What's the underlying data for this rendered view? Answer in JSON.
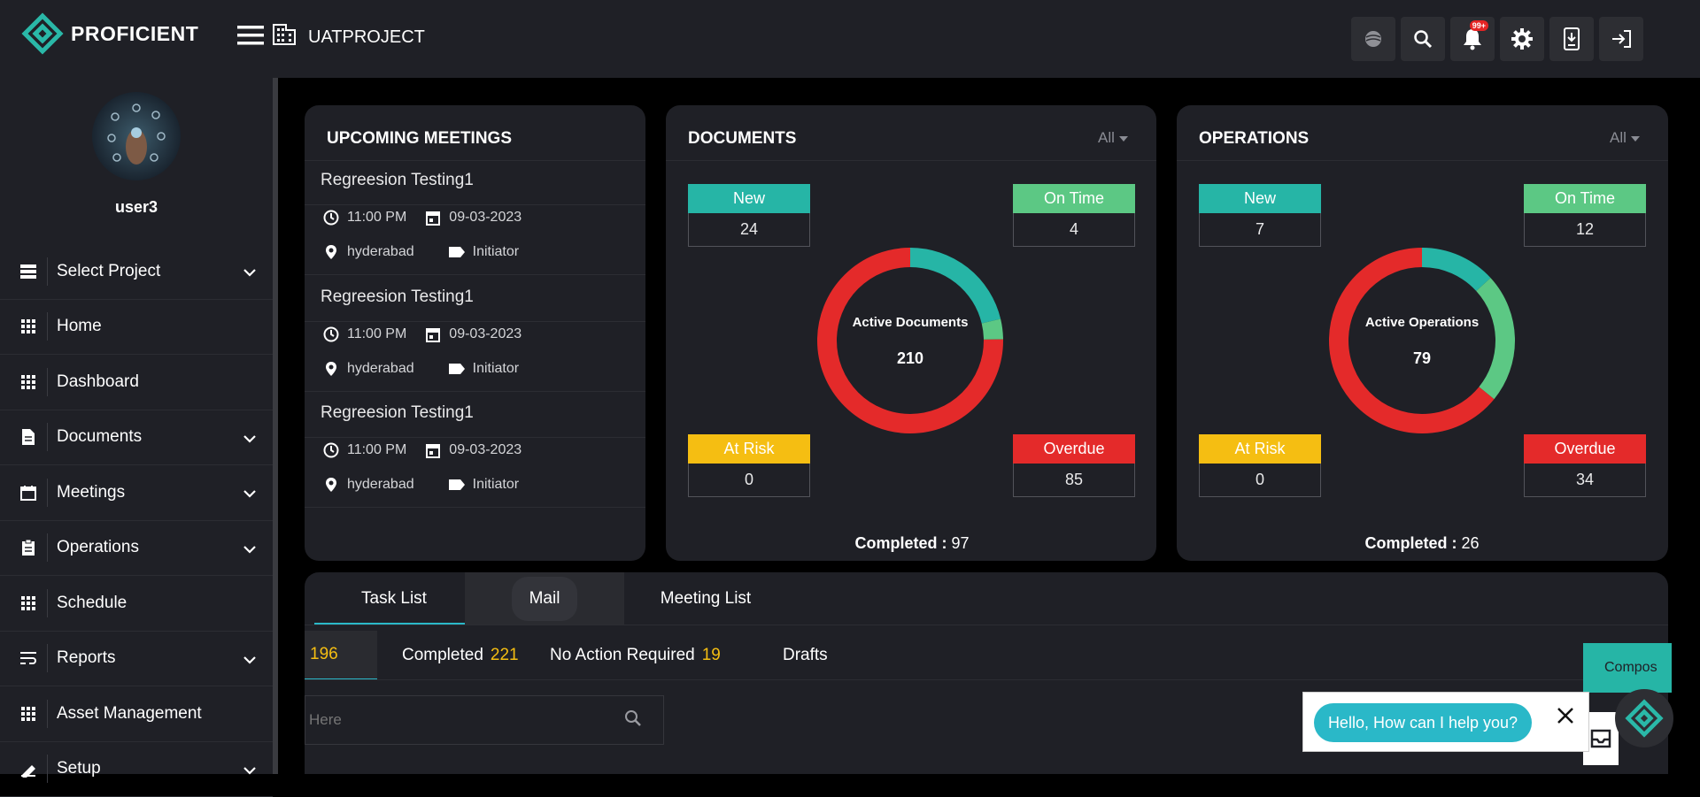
{
  "header": {
    "brand": "PROFICIENT",
    "project": "UATPROJECT",
    "notification_badge": "99+",
    "icons": [
      "globe-icon",
      "search-icon",
      "bell-icon",
      "gear-icon",
      "download-icon",
      "logout-icon"
    ]
  },
  "sidebar": {
    "username": "user3",
    "items": [
      {
        "label": "Select Project",
        "icon": "layers-icon",
        "has_chevron": true
      },
      {
        "label": "Home",
        "icon": "grid-icon",
        "has_chevron": false
      },
      {
        "label": "Dashboard",
        "icon": "grid-icon",
        "has_chevron": false
      },
      {
        "label": "Documents",
        "icon": "document-icon",
        "has_chevron": true
      },
      {
        "label": "Meetings",
        "icon": "calendar-icon",
        "has_chevron": true
      },
      {
        "label": "Operations",
        "icon": "clipboard-icon",
        "has_chevron": true
      },
      {
        "label": "Schedule",
        "icon": "grid-icon",
        "has_chevron": false
      },
      {
        "label": "Reports",
        "icon": "wrap-icon",
        "has_chevron": true
      },
      {
        "label": "Asset Management",
        "icon": "grid-icon",
        "has_chevron": false
      },
      {
        "label": "Setup",
        "icon": "setup-icon",
        "has_chevron": true
      }
    ]
  },
  "meetings": {
    "title": "UPCOMING MEETINGS",
    "items": [
      {
        "title": "Regreesion Testing1",
        "time": "11:00 PM",
        "date": "09-03-2023",
        "location": "hyderabad",
        "role": "Initiator"
      },
      {
        "title": "Regreesion Testing1",
        "time": "11:00 PM",
        "date": "09-03-2023",
        "location": "hyderabad",
        "role": "Initiator"
      },
      {
        "title": "Regreesion Testing1",
        "time": "11:00 PM",
        "date": "09-03-2023",
        "location": "hyderabad",
        "role": "Initiator"
      }
    ]
  },
  "documents": {
    "title": "DOCUMENTS",
    "filter": "All",
    "new_label": "New",
    "new_value": "24",
    "ontime_label": "On Time",
    "ontime_value": "4",
    "atrisk_label": "At Risk",
    "atrisk_value": "0",
    "overdue_label": "Overdue",
    "overdue_value": "85",
    "center_label": "Active Documents",
    "center_value": "210",
    "completed_label": "Completed :",
    "completed_value": "97"
  },
  "operations": {
    "title": "OPERATIONS",
    "filter": "All",
    "new_label": "New",
    "new_value": "7",
    "ontime_label": "On Time",
    "ontime_value": "12",
    "atrisk_label": "At Risk",
    "atrisk_value": "0",
    "overdue_label": "Overdue",
    "overdue_value": "34",
    "center_label": "Active Operations",
    "center_value": "79",
    "completed_label": "Completed :",
    "completed_value": "26"
  },
  "chart_data": [
    {
      "type": "pie",
      "categories": [
        "New",
        "On Time",
        "At Risk",
        "Overdue"
      ],
      "values": [
        24,
        4,
        0,
        85
      ],
      "colors": [
        "#26b5a6",
        "#5cc884",
        "#f5be12",
        "#e42a2a"
      ]
    },
    {
      "type": "pie",
      "categories": [
        "New",
        "On Time",
        "At Risk",
        "Overdue"
      ],
      "values": [
        7,
        12,
        0,
        34
      ],
      "colors": [
        "#26b5a6",
        "#5cc884",
        "#f5be12",
        "#e42a2a"
      ]
    }
  ],
  "tasks": {
    "tabs": [
      "Task List",
      "Mail",
      "Meeting List"
    ],
    "active_count": "196",
    "completed_label": "Completed",
    "completed_count": "221",
    "no_action_label": "No Action Required",
    "no_action_count": "19",
    "drafts_label": "Drafts",
    "search_placeholder": "Here",
    "compose": "Compos"
  },
  "chat": {
    "prompt": "Hello, How can I help you?"
  },
  "colors": {
    "teal": "#26b5a6",
    "green": "#5cc884",
    "yellow": "#f5be12",
    "red": "#e42a2a",
    "panel": "#1f2026"
  }
}
